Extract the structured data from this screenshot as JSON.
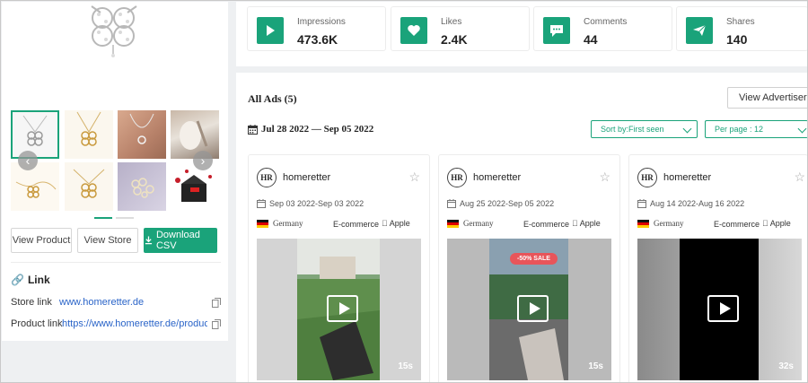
{
  "product_panel": {
    "buttons": {
      "view_product": "View Product",
      "view_store": "View Store",
      "download_csv": "Download CSV"
    },
    "link_section": {
      "title": "Link",
      "store_link_label": "Store link",
      "store_link_value": "www.homeretter.de",
      "product_link_label": "Product link",
      "product_link_value": "https://www.homeretter.de/products/kl..."
    },
    "carousel": {
      "prev_icon": "chevron-left-icon",
      "next_icon": "chevron-right-icon"
    }
  },
  "stats": [
    {
      "label": "Impressions",
      "value": "473.6K",
      "icon": "play-icon"
    },
    {
      "label": "Likes",
      "value": "2.4K",
      "icon": "heart-icon"
    },
    {
      "label": "Comments",
      "value": "44",
      "icon": "comment-icon"
    },
    {
      "label": "Shares",
      "value": "140",
      "icon": "send-icon"
    }
  ],
  "ads": {
    "title": "All Ads (5)",
    "view_advertisers": "View Advertisers",
    "date_range": "Jul 28 2022 — Sep 05 2022",
    "sort_by": "Sort by:First seen",
    "per_page": "Per page : 12",
    "cards": [
      {
        "advertiser": "homeretter",
        "logo_text": "HR",
        "date": "Sep 03 2022-Sep 03 2022",
        "country": "Germany",
        "category": "E-commerce",
        "os": "Apple",
        "duration": "15s"
      },
      {
        "advertiser": "homeretter",
        "logo_text": "HR",
        "date": "Aug 25 2022-Sep 05 2022",
        "country": "Germany",
        "category": "E-commerce",
        "os": "Apple",
        "duration": "15s",
        "badge": "-50% SALE"
      },
      {
        "advertiser": "homeretter",
        "logo_text": "HR",
        "date": "Aug 14 2022-Aug 16 2022",
        "country": "Germany",
        "category": "E-commerce",
        "os": "Apple",
        "duration": "32s"
      }
    ]
  },
  "colors": {
    "accent": "#1aa37a",
    "link": "#2a64c8",
    "background": "#eef0f2"
  }
}
